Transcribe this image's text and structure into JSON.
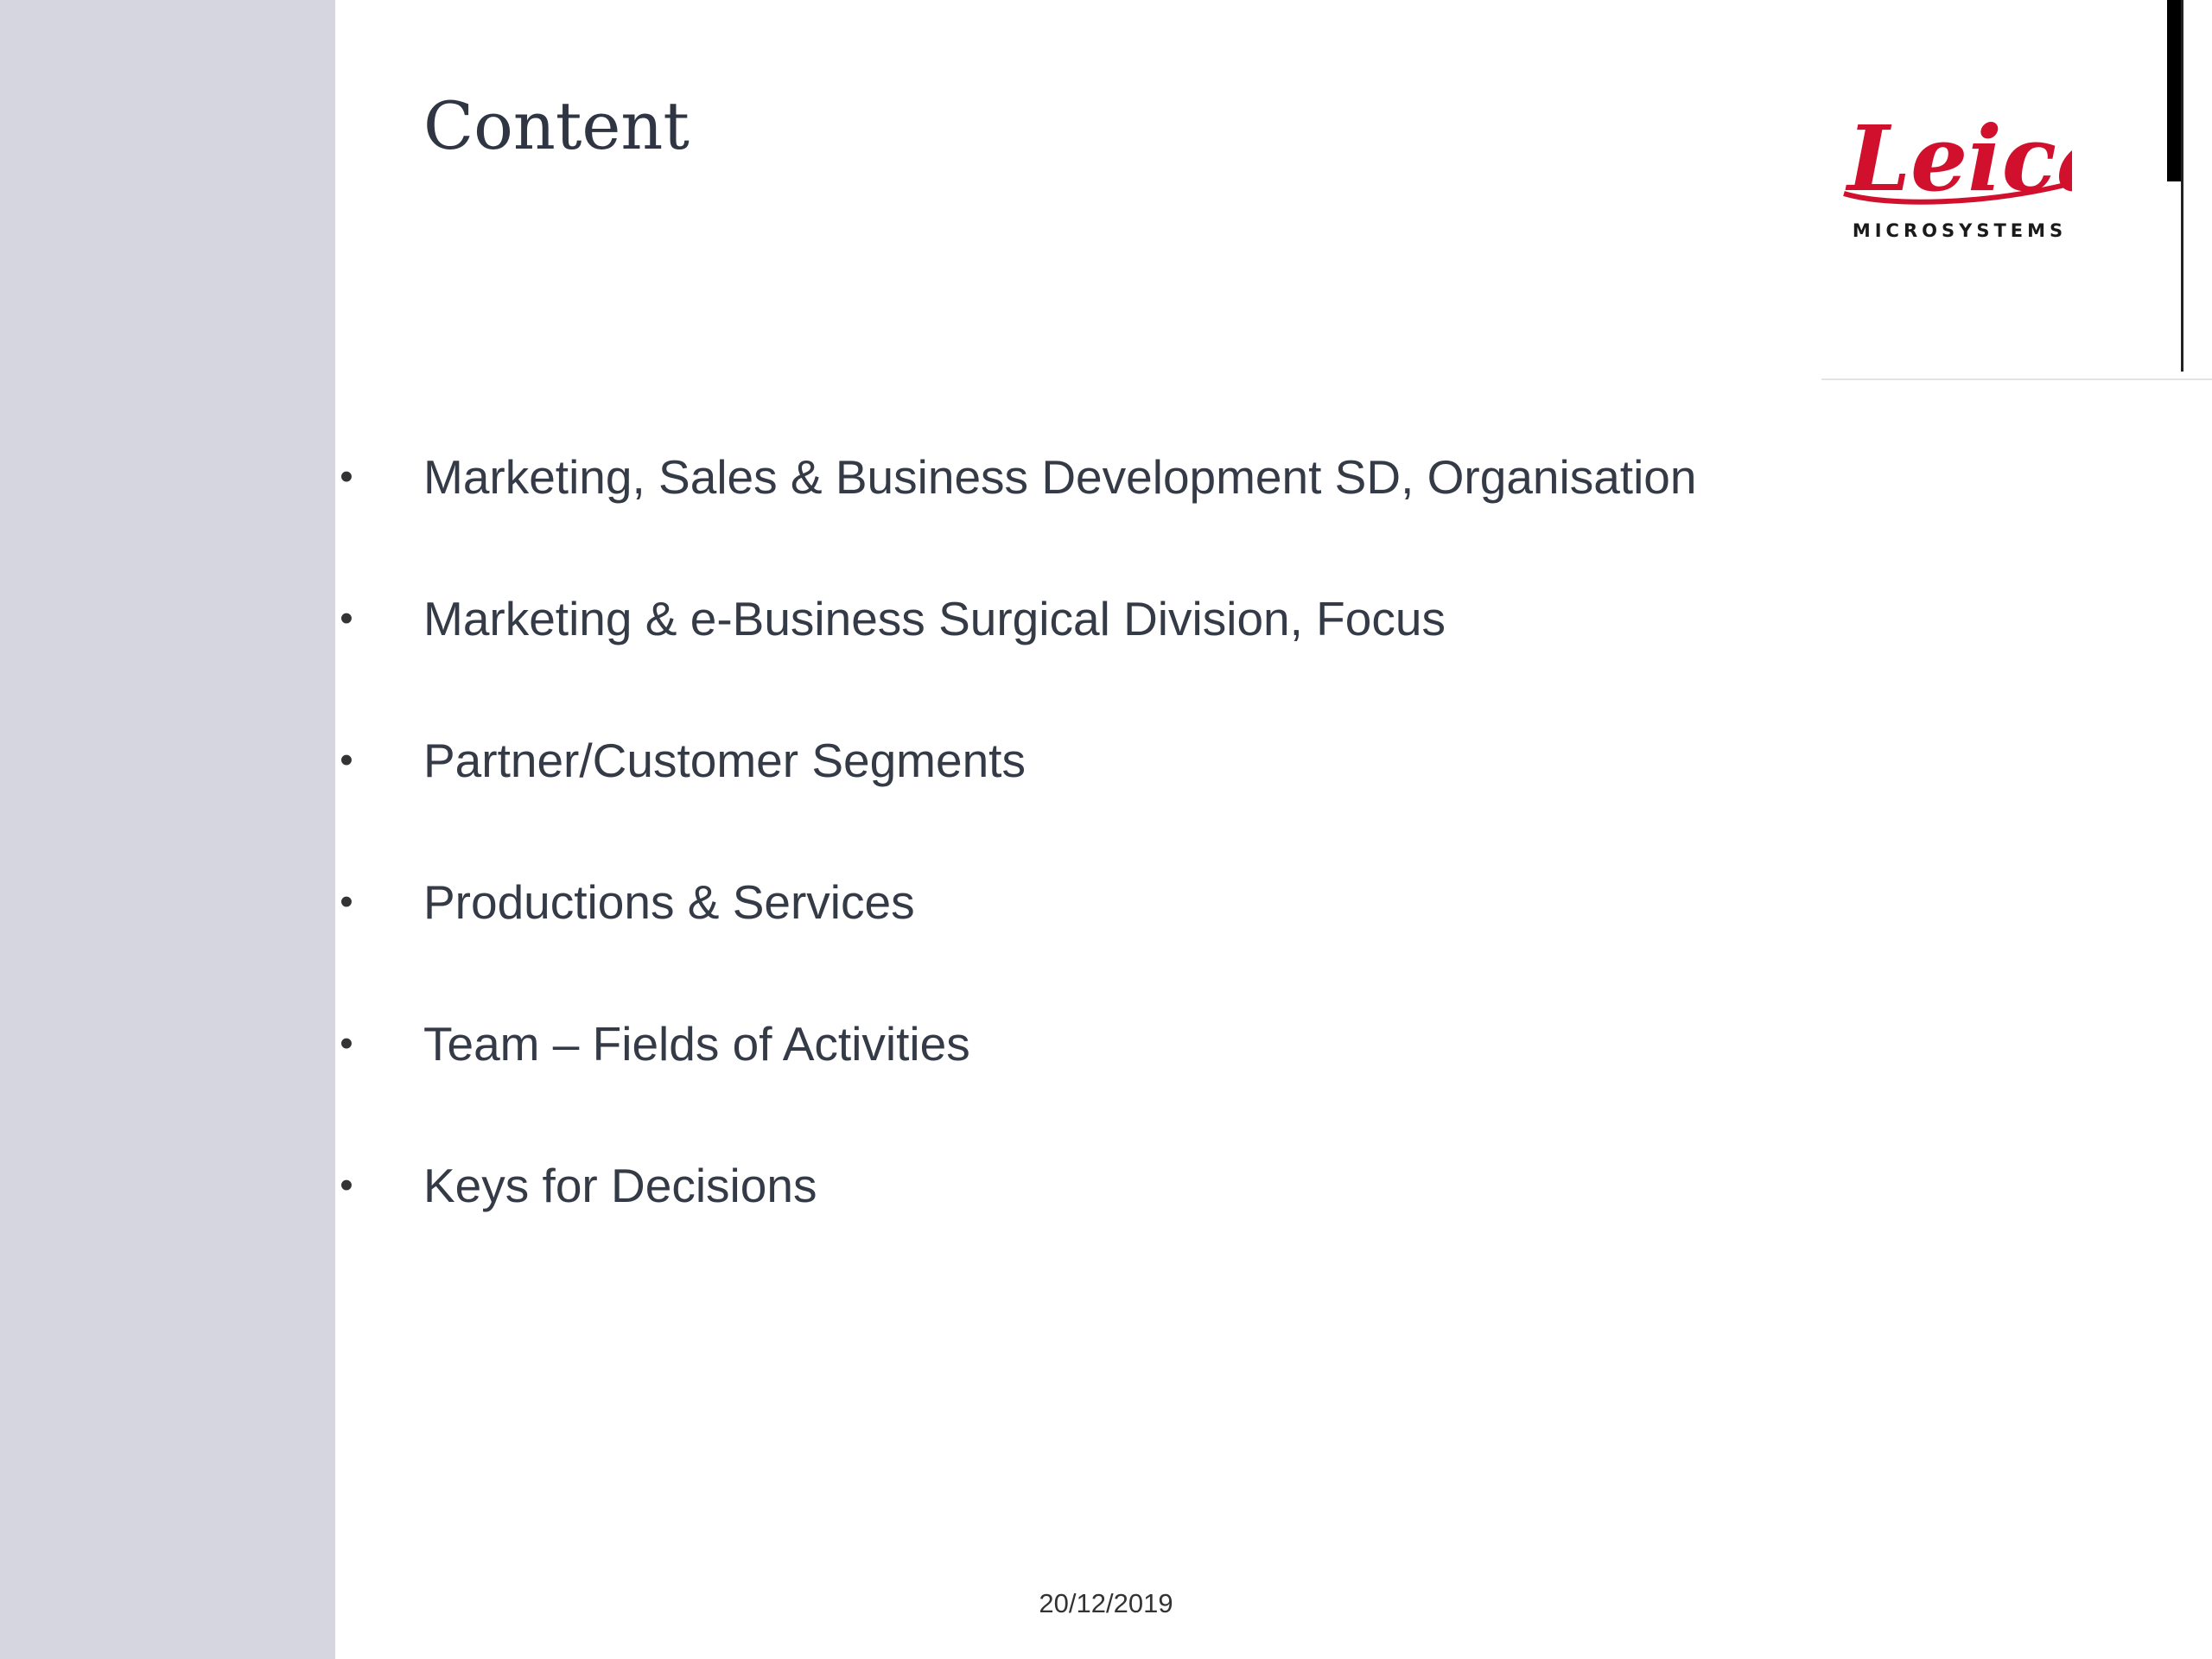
{
  "slide": {
    "title": "Content",
    "brand": {
      "wordmark": "Leica",
      "subline": "MICROSYSTEMS",
      "color": "#d0102c"
    },
    "items": [
      {
        "bullet": "•",
        "text": "Marketing, Sales & Business Development SD, Organisation"
      },
      {
        "bullet": "•",
        "text": "Marketing & e-Business Surgical Division, Focus"
      },
      {
        "bullet": "•",
        "text": "Partner/Customer Segments"
      },
      {
        "bullet": "•",
        "text": "Productions & Services"
      },
      {
        "bullet": "•",
        "text": "Team – Fields of Activities"
      },
      {
        "bullet": "•",
        "text": "Keys for Decisions"
      }
    ],
    "footer_date": "20/12/2019",
    "colors": {
      "band": "#d5d6e0",
      "text": "#343a46"
    }
  }
}
